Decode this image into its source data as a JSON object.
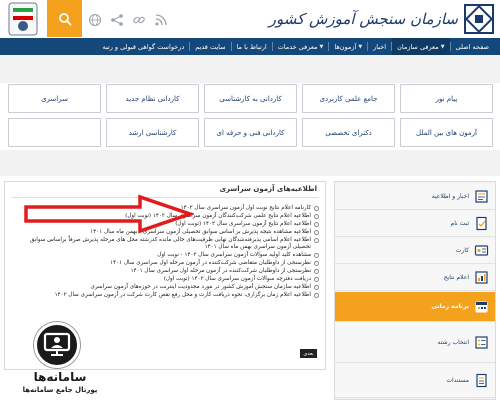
{
  "header": {
    "brand_text": "سازمان سنجش آموزش کشور",
    "icons": [
      "search-icon",
      "globe-icon",
      "share-icon",
      "link-icon",
      "rss-icon"
    ],
    "accent_color": "#f4a21e",
    "nav_color": "#15487a"
  },
  "nav": {
    "items": [
      {
        "label": "صفحه اصلی"
      },
      {
        "label": "معرفی سازمان"
      },
      {
        "label": "اخبار"
      },
      {
        "label": "آزمون‌ها"
      },
      {
        "label": "معرفی خدمات"
      },
      {
        "label": "ارتباط با ما"
      },
      {
        "label": "سایت قدیم"
      },
      {
        "label": "درخواست گواهی قبولی و رتبه"
      }
    ]
  },
  "quick_links": [
    "پیام نور",
    "جامع علمی کاربردی",
    "کاردانی به کارشناسی",
    "کاردانی نظام جدید",
    "سراسری",
    "آزمون های بین الملل",
    "دکترای تخصصی",
    "کاردانی فنی و حرفه ای",
    "کارشناسی ارشد",
    ""
  ],
  "announcements": {
    "title": "اطلاعیه‌های آزمون سراسری",
    "items": [
      "کارنامه اعلام نتایج نوبت اول آزمون سراسری سال ۱۴۰۲",
      "اطلاعیه اعلام نتایج علمی شرکت‌کنندگان آزمون سراسری سال ۱۴۰۲ (نوبت اول)",
      "اطلاعیه اعلام نتایج آزمون سراسری سال ۱۴۰۲ (نوبت اول)",
      "اطلاعیه مشاهده نتیجه پذیرش بر اساس سوابق تحصیلی آزمون سراسری - بهمن ماه سال ۱۴۰۱",
      "اطلاعیه اعلام اسامی پذیرفته‌شدگان نهایی ظرفیت‌های خالی مانده کدرشته محل های مرحله پذیرش صرفاً براساس سوابق تحصیلی آزمون سراسری بهمن ماه سال ۱۴۰۱",
      "مشاهده کلید اولیه سوالات آزمون سراسری سال ۱۴۰۲ - نوبت اول",
      "نظرسنجی از داوطلبان متقاضی شرکت‌کننده در آزمون مرحله اول سراسری سال ۱۴۰۱",
      "نظرسنجی از داوطلبان شرکت‌کننده در آزمون مرحله اول سراسری سال ۱۴۰۱",
      "دریافت دفترچه سوالات آزمون سراسری سال ۱۴۰۲ (نوبت اول)",
      "اطلاعیه سازمان سنجش آموزش کشور در مورد مجدودیت اینترنت در حوزه‌های آزمون سراسری",
      "اطلاعیه اعلام زمان برگزاری، نحوه دریافت کارت و محل رفع نقص کارت شرکت در آزمون سراسری سال ۱۴۰۲"
    ],
    "more_label": "بعدی"
  },
  "sidebar": {
    "items": [
      {
        "label": "اخبار و اطلاعیه",
        "icon": "news-icon"
      },
      {
        "label": "ثبت نام",
        "icon": "register-icon"
      },
      {
        "label": "کارت",
        "icon": "card-icon"
      },
      {
        "label": "اعلام نتایج",
        "icon": "results-icon"
      },
      {
        "label": "برنامه زمانی",
        "icon": "schedule-icon"
      },
      {
        "label": "انتخاب رشته",
        "icon": "field-selection-icon"
      },
      {
        "label": "مستندات",
        "icon": "documents-icon"
      }
    ],
    "active_index": 4
  },
  "watermark": {
    "title": "سامانه‌ها",
    "subtitle": "پورتال جامع سامانه‌ها"
  }
}
